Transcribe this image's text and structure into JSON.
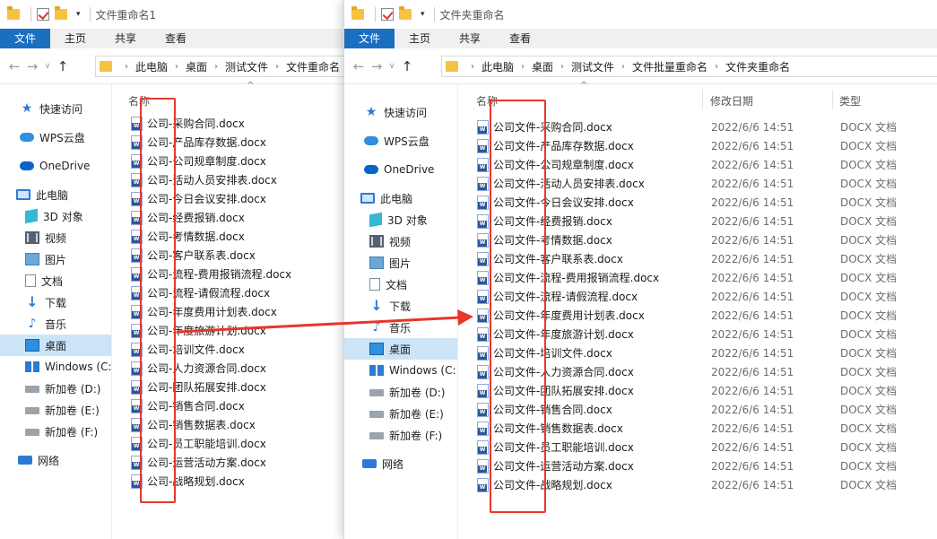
{
  "ribbon_tabs": [
    "文件",
    "主页",
    "共享",
    "查看"
  ],
  "left_window": {
    "title": "文件重命名1",
    "breadcrumbs": [
      "此电脑",
      "桌面",
      "测试文件",
      "文件重命名"
    ],
    "columns": {
      "name": "名称"
    },
    "sidebar": [
      {
        "label": "快速访问",
        "icon": "star-icon"
      },
      {
        "label": "WPS云盘",
        "icon": "cloud-icon"
      },
      {
        "label": "OneDrive",
        "icon": "onedrive-icon"
      },
      {
        "label": "此电脑",
        "icon": "computer-icon"
      },
      {
        "label": "3D 对象",
        "icon": "cube-icon"
      },
      {
        "label": "视频",
        "icon": "video-icon"
      },
      {
        "label": "图片",
        "icon": "pictures-icon"
      },
      {
        "label": "文档",
        "icon": "documents-icon"
      },
      {
        "label": "下载",
        "icon": "download-icon"
      },
      {
        "label": "音乐",
        "icon": "music-icon"
      },
      {
        "label": "桌面",
        "icon": "desktop-icon",
        "selected": true
      },
      {
        "label": "Windows (C:",
        "icon": "windows-drive-icon"
      },
      {
        "label": "新加卷 (D:)",
        "icon": "drive-icon"
      },
      {
        "label": "新加卷 (E:)",
        "icon": "drive-icon"
      },
      {
        "label": "新加卷 (F:)",
        "icon": "drive-icon"
      },
      {
        "label": "网络",
        "icon": "network-icon"
      }
    ],
    "files": [
      "公司-采购合同.docx",
      "公司-产品库存数据.docx",
      "公司-公司规章制度.docx",
      "公司-活动人员安排表.docx",
      "公司-今日会议安排.docx",
      "公司-经费报销.docx",
      "公司-考情数据.docx",
      "公司-客户联系表.docx",
      "公司-流程-费用报销流程.docx",
      "公司-流程-请假流程.docx",
      "公司-年度费用计划表.docx",
      "公司-年度旅游计划.docx",
      "公司-培训文件.docx",
      "公司-人力资源合同.docx",
      "公司-团队拓展安排.docx",
      "公司-销售合同.docx",
      "公司-销售数据表.docx",
      "公司-员工职能培训.docx",
      "公司-运营活动方案.docx",
      "公司-战略规划.docx"
    ]
  },
  "right_window": {
    "title": "文件夹重命名",
    "breadcrumbs": [
      "此电脑",
      "桌面",
      "测试文件",
      "文件批量重命名",
      "文件夹重命名"
    ],
    "columns": {
      "name": "名称",
      "modified": "修改日期",
      "type": "类型"
    },
    "sidebar": [
      {
        "label": "快速访问",
        "icon": "star-icon"
      },
      {
        "label": "WPS云盘",
        "icon": "cloud-icon"
      },
      {
        "label": "OneDrive",
        "icon": "onedrive-icon"
      },
      {
        "label": "此电脑",
        "icon": "computer-icon"
      },
      {
        "label": "3D 对象",
        "icon": "cube-icon"
      },
      {
        "label": "视频",
        "icon": "video-icon"
      },
      {
        "label": "图片",
        "icon": "pictures-icon"
      },
      {
        "label": "文档",
        "icon": "documents-icon"
      },
      {
        "label": "下载",
        "icon": "download-icon"
      },
      {
        "label": "音乐",
        "icon": "music-icon"
      },
      {
        "label": "桌面",
        "icon": "desktop-icon",
        "selected": true
      },
      {
        "label": "Windows (C:",
        "icon": "windows-drive-icon"
      },
      {
        "label": "新加卷 (D:)",
        "icon": "drive-icon"
      },
      {
        "label": "新加卷 (E:)",
        "icon": "drive-icon"
      },
      {
        "label": "新加卷 (F:)",
        "icon": "drive-icon"
      },
      {
        "label": "网络",
        "icon": "network-icon"
      }
    ],
    "files": [
      {
        "name": "公司文件-采购合同.docx",
        "date": "2022/6/6 14:51",
        "type": "DOCX 文档"
      },
      {
        "name": "公司文件-产品库存数据.docx",
        "date": "2022/6/6 14:51",
        "type": "DOCX 文档"
      },
      {
        "name": "公司文件-公司规章制度.docx",
        "date": "2022/6/6 14:51",
        "type": "DOCX 文档"
      },
      {
        "name": "公司文件-活动人员安排表.docx",
        "date": "2022/6/6 14:51",
        "type": "DOCX 文档"
      },
      {
        "name": "公司文件-今日会议安排.docx",
        "date": "2022/6/6 14:51",
        "type": "DOCX 文档"
      },
      {
        "name": "公司文件-经费报销.docx",
        "date": "2022/6/6 14:51",
        "type": "DOCX 文档"
      },
      {
        "name": "公司文件-考情数据.docx",
        "date": "2022/6/6 14:51",
        "type": "DOCX 文档"
      },
      {
        "name": "公司文件-客户联系表.docx",
        "date": "2022/6/6 14:51",
        "type": "DOCX 文档"
      },
      {
        "name": "公司文件-流程-费用报销流程.docx",
        "date": "2022/6/6 14:51",
        "type": "DOCX 文档"
      },
      {
        "name": "公司文件-流程-请假流程.docx",
        "date": "2022/6/6 14:51",
        "type": "DOCX 文档"
      },
      {
        "name": "公司文件-年度费用计划表.docx",
        "date": "2022/6/6 14:51",
        "type": "DOCX 文档"
      },
      {
        "name": "公司文件-年度旅游计划.docx",
        "date": "2022/6/6 14:51",
        "type": "DOCX 文档"
      },
      {
        "name": "公司文件-培训文件.docx",
        "date": "2022/6/6 14:51",
        "type": "DOCX 文档"
      },
      {
        "name": "公司文件-人力资源合同.docx",
        "date": "2022/6/6 14:51",
        "type": "DOCX 文档"
      },
      {
        "name": "公司文件-团队拓展安排.docx",
        "date": "2022/6/6 14:51",
        "type": "DOCX 文档"
      },
      {
        "name": "公司文件-销售合同.docx",
        "date": "2022/6/6 14:51",
        "type": "DOCX 文档"
      },
      {
        "name": "公司文件-销售数据表.docx",
        "date": "2022/6/6 14:51",
        "type": "DOCX 文档"
      },
      {
        "name": "公司文件-员工职能培训.docx",
        "date": "2022/6/6 14:51",
        "type": "DOCX 文档"
      },
      {
        "name": "公司文件-运营活动方案.docx",
        "date": "2022/6/6 14:51",
        "type": "DOCX 文档"
      },
      {
        "name": "公司文件-战略规划.docx",
        "date": "2022/6/6 14:51",
        "type": "DOCX 文档"
      }
    ]
  },
  "colors": {
    "accent": "#1a6fc1",
    "selection": "#cce4f7",
    "annotation_red": "#e8362b"
  }
}
